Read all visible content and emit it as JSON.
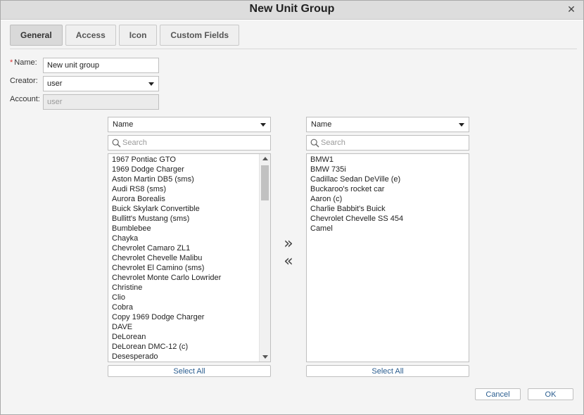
{
  "window": {
    "title": "New Unit Group",
    "close_icon": "close-icon"
  },
  "tabs": [
    {
      "label": "General",
      "active": true
    },
    {
      "label": "Access",
      "active": false
    },
    {
      "label": "Icon",
      "active": false
    },
    {
      "label": "Custom Fields",
      "active": false
    }
  ],
  "form": {
    "name": {
      "required_mark": "*",
      "label": "Name:",
      "value": "New unit group"
    },
    "creator": {
      "label": "Creator:",
      "value": "user"
    },
    "account": {
      "label": "Account:",
      "placeholder": "user"
    }
  },
  "left_panel": {
    "sort_value": "Name",
    "search_placeholder": "Search",
    "items": [
      "1967 Pontiac GTO",
      "1969 Dodge Charger",
      "Aston Martin DB5 (sms)",
      "Audi RS8 (sms)",
      "Aurora Borealis",
      "Buick Skylark Convertible",
      "Bullitt's Mustang (sms)",
      "Bumblebee",
      "Chayka",
      "Chevrolet Camaro ZL1",
      "Chevrolet Chevelle Malibu",
      "Chevrolet El Camino (sms)",
      "Chevrolet Monte Carlo Lowrider",
      "Christine",
      "Clio",
      "Cobra",
      "Copy 1969 Dodge Charger",
      "DAVE",
      "DeLorean",
      "DeLorean DMC-12 (c)",
      "Desesperado"
    ],
    "select_all_label": "Select All"
  },
  "right_panel": {
    "sort_value": "Name",
    "search_placeholder": "Search",
    "items": [
      "BMW1",
      "BMW 735i",
      "Cadillac Sedan DeVille (e)",
      "Buckaroo's rocket car",
      "Aaron (c)",
      "Charlie Babbit's Buick",
      "Chevrolet Chevelle SS 454",
      "Camel"
    ],
    "select_all_label": "Select All"
  },
  "transfer": {
    "add_all": "»",
    "remove_all": "«"
  },
  "footer": {
    "cancel_label": "Cancel",
    "ok_label": "OK"
  }
}
